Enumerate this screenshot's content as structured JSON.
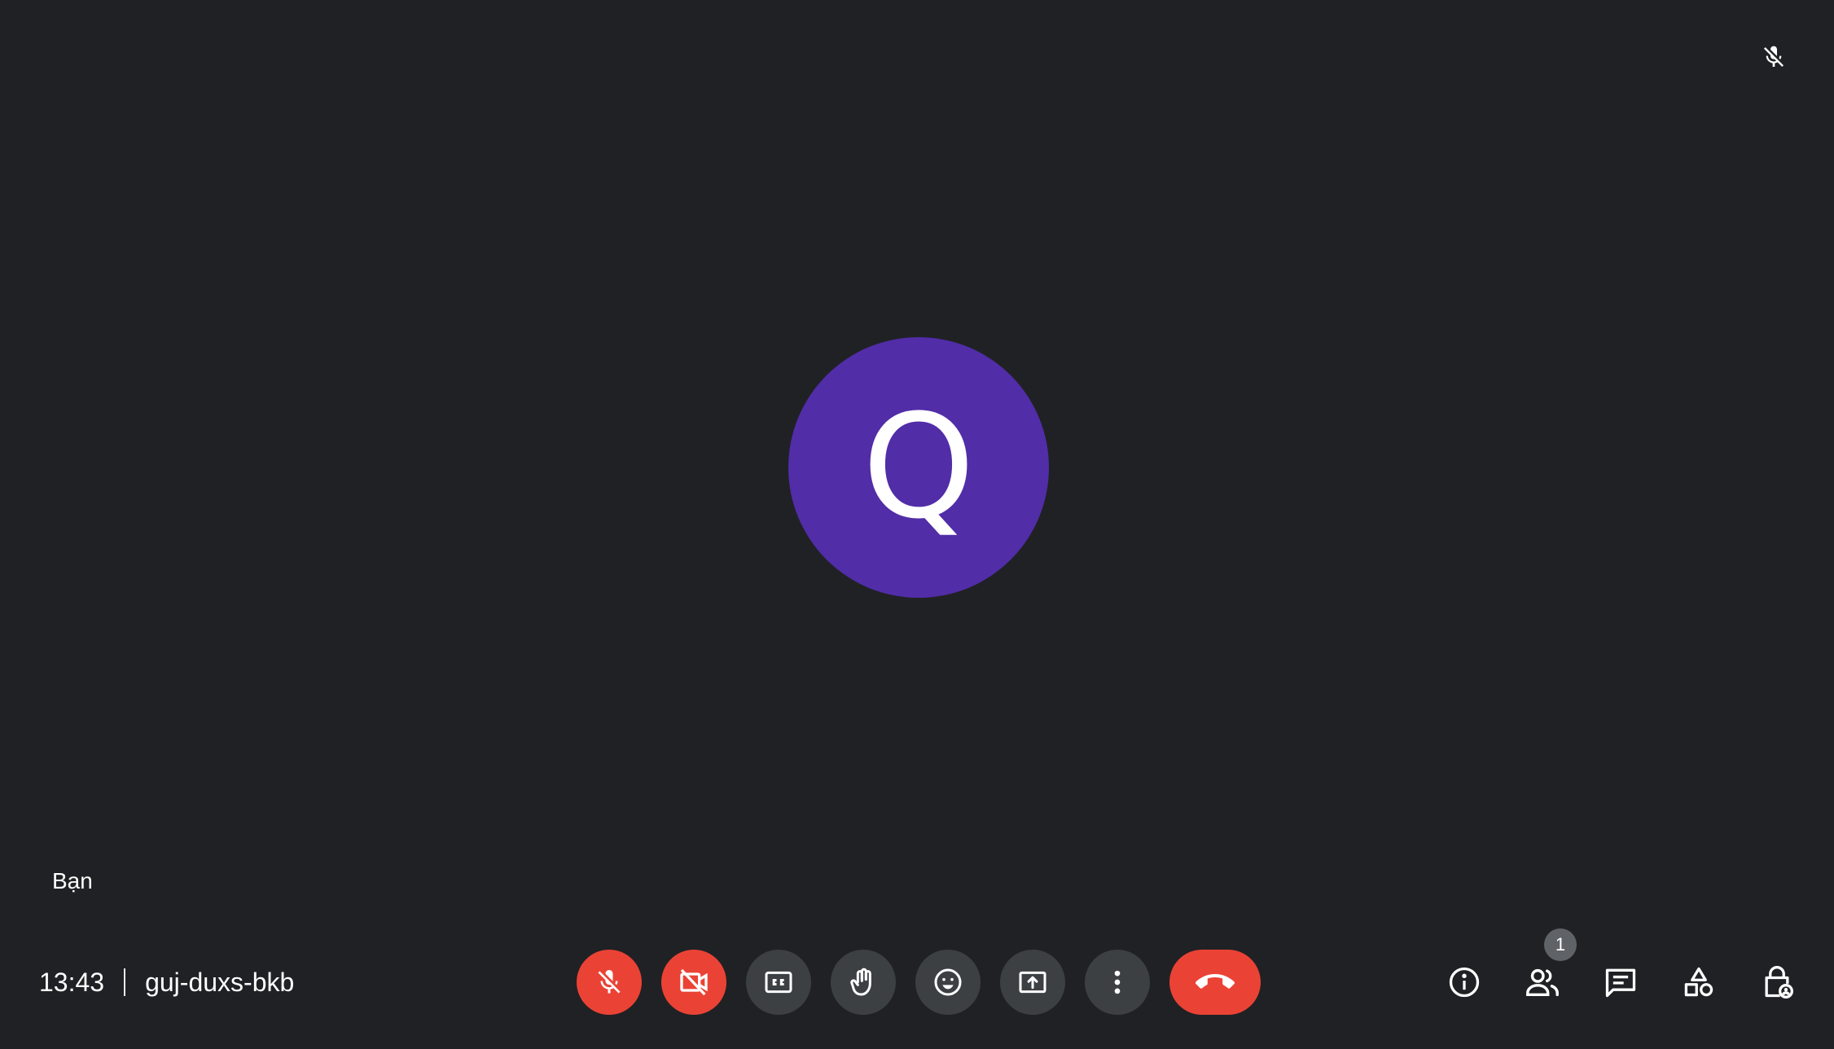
{
  "tile": {
    "avatar_initial": "Q",
    "avatar_color": "#512da8",
    "participant_name": "Bạn",
    "mic_status_icon": "mic-off-icon"
  },
  "meeting": {
    "time": "13:43",
    "code": "guj-duxs-bkb"
  },
  "controls": [
    {
      "name": "microphone",
      "icon": "mic-off-icon",
      "state": "off"
    },
    {
      "name": "camera",
      "icon": "videocam-off-icon",
      "state": "off"
    },
    {
      "name": "captions",
      "icon": "closed-caption-icon"
    },
    {
      "name": "raise-hand",
      "icon": "hand-icon"
    },
    {
      "name": "reactions",
      "icon": "emoji-icon"
    },
    {
      "name": "present",
      "icon": "present-screen-icon"
    },
    {
      "name": "more-options",
      "icon": "more-vert-icon"
    },
    {
      "name": "leave-call",
      "icon": "call-end-icon"
    }
  ],
  "right_actions": [
    {
      "name": "meeting-details",
      "icon": "info-icon"
    },
    {
      "name": "people",
      "icon": "people-icon",
      "badge": "1"
    },
    {
      "name": "chat",
      "icon": "chat-icon"
    },
    {
      "name": "activities",
      "icon": "shapes-icon"
    },
    {
      "name": "host-controls",
      "icon": "lock-person-icon"
    }
  ],
  "colors": {
    "background": "#202124",
    "control_bg": "#3c4043",
    "danger": "#ea4335",
    "badge_bg": "#5f6368"
  }
}
